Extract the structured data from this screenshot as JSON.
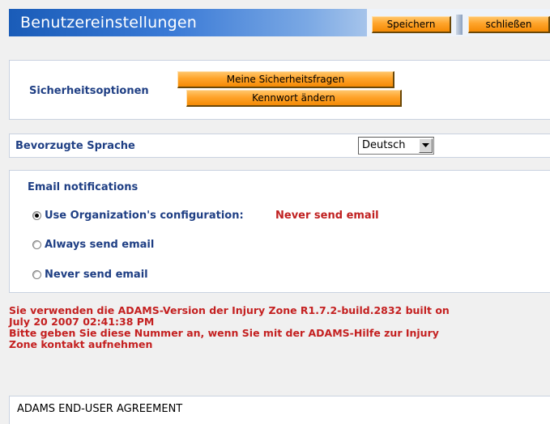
{
  "header": {
    "title": "Benutzereinstellungen",
    "save_label": "Speichern",
    "close_label": "schließen"
  },
  "security": {
    "label": "Sicherheitsoptionen",
    "questions_button": "Meine Sicherheitsfragen",
    "password_button": "Kennwort ändern"
  },
  "language": {
    "label": "Bevorzugte Sprache",
    "selected": "Deutsch"
  },
  "email": {
    "title": "Email notifications",
    "options": [
      {
        "label": "Use Organization's configuration:",
        "extra": "Never send email",
        "checked": true
      },
      {
        "label": "Always send email",
        "checked": false
      },
      {
        "label": "Never send email",
        "checked": false
      }
    ]
  },
  "version_message": {
    "line1": " Sie verwenden die ADAMS-Version der Injury Zone R1.7.2-build.2832 built on",
    "line2": "July 20 2007 02:41:38 PM",
    "line3": "Bitte geben Sie diese Nummer an, wenn Sie mit der ADAMS-Hilfe zur Injury",
    "line4": "Zone kontakt aufnehmen"
  },
  "agreement": {
    "title": "ADAMS END-USER AGREEMENT"
  },
  "colors": {
    "header_blue": "#1a5cb8",
    "label_blue": "#1f3f84",
    "warning_red": "#c42020",
    "button_orange": "#ffa42a"
  }
}
